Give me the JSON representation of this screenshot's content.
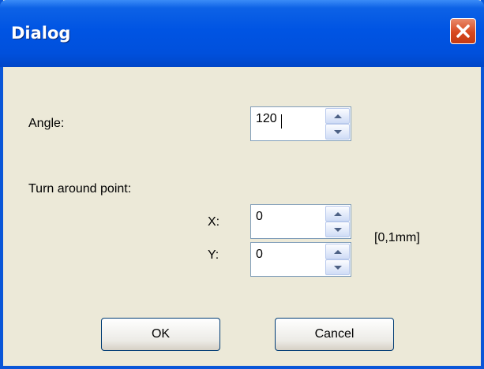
{
  "window": {
    "title": "Dialog"
  },
  "angle": {
    "label": "Angle:",
    "value": "120"
  },
  "turn_around_point": {
    "label": "Turn around point:",
    "x_label": "X:",
    "x_value": "0",
    "y_label": "Y:",
    "y_value": "0",
    "unit": "[0,1mm]"
  },
  "buttons": {
    "ok": "OK",
    "cancel": "Cancel"
  },
  "icons": {
    "close": "close-icon",
    "up": "arrow-up-icon",
    "down": "arrow-down-icon"
  },
  "colors": {
    "titlebar": "#0054e3",
    "close": "#d8491f",
    "background": "#ece9d8"
  }
}
